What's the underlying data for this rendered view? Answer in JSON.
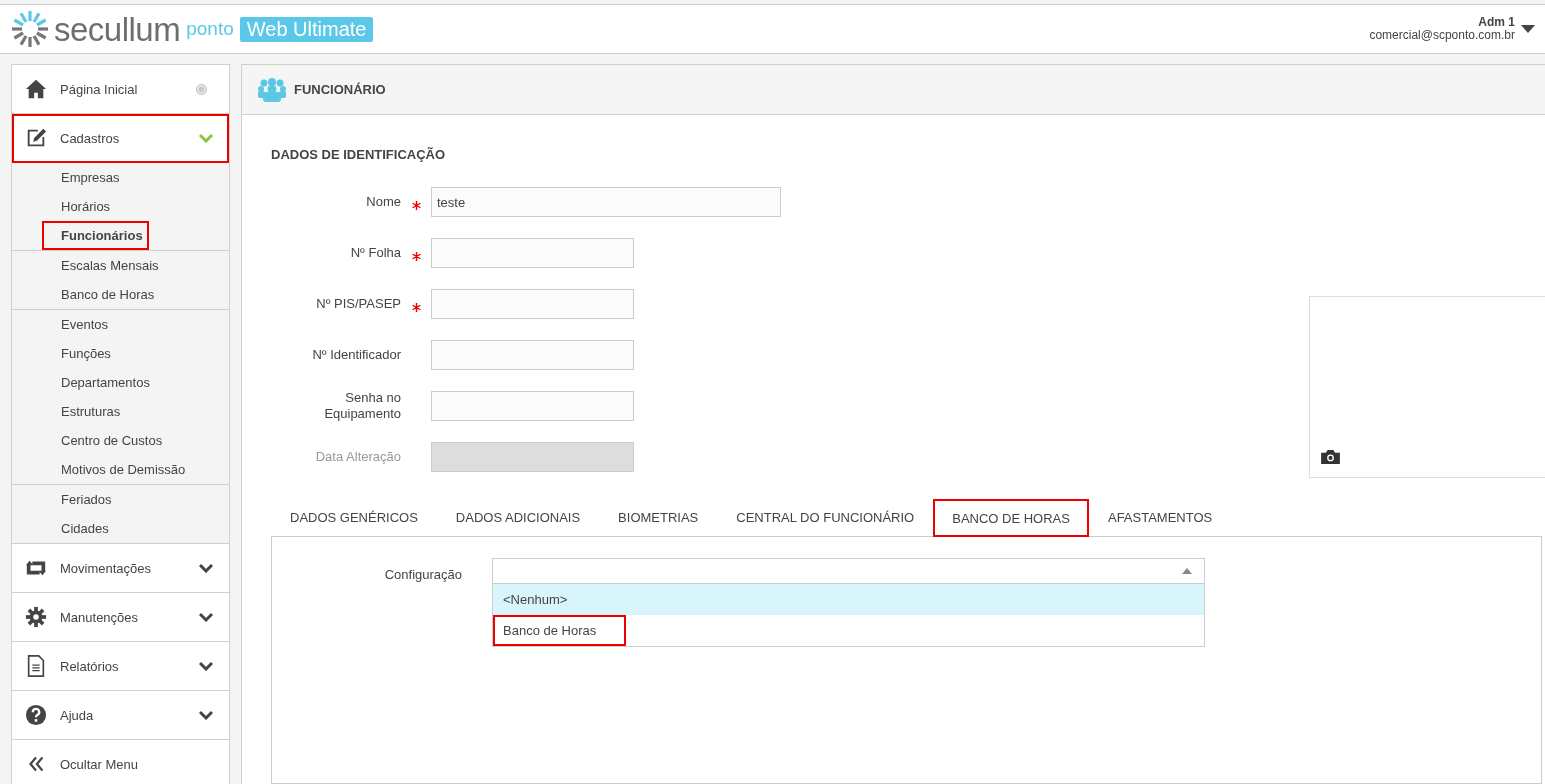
{
  "header": {
    "brand": "secullum",
    "product": "ponto",
    "edition": "Web Ultimate",
    "user": {
      "name": "Adm 1",
      "email": "comercial@scponto.com.br"
    }
  },
  "sidebar": {
    "items": [
      {
        "label": "Página Inicial",
        "kind": "link",
        "highlighted": false
      },
      {
        "label": "Cadastros",
        "kind": "menu",
        "expanded": true,
        "highlighted": true,
        "groups": [
          {
            "children": [
              {
                "label": "Empresas",
                "selected": false,
                "highlighted": false
              },
              {
                "label": "Horários",
                "selected": false,
                "highlighted": false
              },
              {
                "label": "Funcionários",
                "selected": true,
                "highlighted": true
              }
            ]
          },
          {
            "children": [
              {
                "label": "Escalas Mensais",
                "selected": false,
                "highlighted": false
              },
              {
                "label": "Banco de Horas",
                "selected": false,
                "highlighted": false
              }
            ]
          },
          {
            "children": [
              {
                "label": "Eventos",
                "selected": false,
                "highlighted": false
              },
              {
                "label": "Funções",
                "selected": false,
                "highlighted": false
              },
              {
                "label": "Departamentos",
                "selected": false,
                "highlighted": false
              },
              {
                "label": "Estruturas",
                "selected": false,
                "highlighted": false
              },
              {
                "label": "Centro de Custos",
                "selected": false,
                "highlighted": false
              },
              {
                "label": "Motivos de Demissão",
                "selected": false,
                "highlighted": false
              }
            ]
          },
          {
            "children": [
              {
                "label": "Feriados",
                "selected": false,
                "highlighted": false
              },
              {
                "label": "Cidades",
                "selected": false,
                "highlighted": false
              }
            ]
          }
        ]
      },
      {
        "label": "Movimentações",
        "kind": "menu",
        "expanded": false,
        "highlighted": false
      },
      {
        "label": "Manutenções",
        "kind": "menu",
        "expanded": false,
        "highlighted": false
      },
      {
        "label": "Relatórios",
        "kind": "menu",
        "expanded": false,
        "highlighted": false
      },
      {
        "label": "Ajuda",
        "kind": "menu",
        "expanded": false,
        "highlighted": false
      },
      {
        "label": "Ocultar Menu",
        "kind": "action",
        "highlighted": false
      }
    ]
  },
  "page": {
    "title": "FUNCIONÁRIO",
    "section": "DADOS DE IDENTIFICAÇÃO",
    "fields": [
      {
        "label": "Nome",
        "required": true,
        "value": "teste",
        "kind": "wide",
        "disabled": false
      },
      {
        "label": "Nº Folha",
        "required": true,
        "kind": "narrow",
        "disabled": false
      },
      {
        "label": "Nº PIS/PASEP",
        "required": true,
        "kind": "narrow",
        "disabled": false
      },
      {
        "label": "Nº Identificador",
        "required": false,
        "kind": "narrow",
        "disabled": false
      },
      {
        "label": "Senha no Equipamento",
        "required": false,
        "kind": "narrow",
        "disabled": false
      },
      {
        "label": "Data Alteração",
        "required": false,
        "kind": "narrow",
        "disabled": true
      }
    ],
    "tabs": [
      {
        "label": "DADOS GENÉRICOS",
        "selected": false,
        "highlighted": false
      },
      {
        "label": "DADOS ADICIONAIS",
        "selected": false,
        "highlighted": false
      },
      {
        "label": "BIOMETRIAS",
        "selected": false,
        "highlighted": false
      },
      {
        "label": "CENTRAL DO FUNCIONÁRIO",
        "selected": false,
        "highlighted": false
      },
      {
        "label": "BANCO DE HORAS",
        "selected": true,
        "highlighted": true
      },
      {
        "label": "AFASTAMENTOS",
        "selected": false,
        "highlighted": false
      }
    ],
    "config": {
      "label": "Configuração",
      "expanded": true,
      "options": [
        {
          "label": "<Nenhum>",
          "selected": true,
          "highlighted": false
        },
        {
          "label": "Banco de Horas",
          "selected": false,
          "highlighted": true
        }
      ]
    }
  }
}
